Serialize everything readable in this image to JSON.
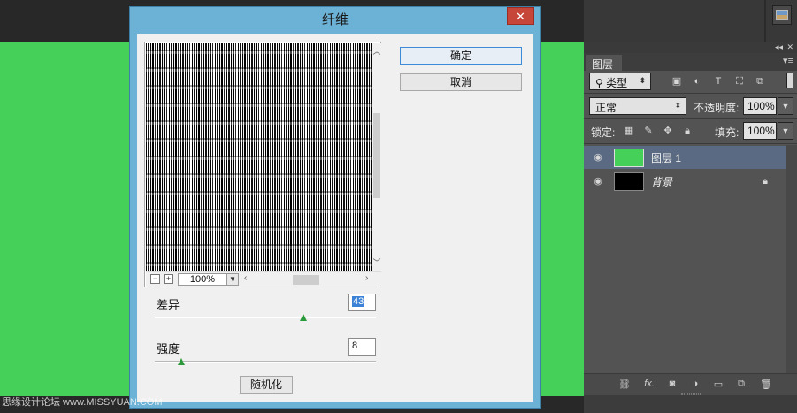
{
  "dialog": {
    "title": "纤维",
    "close_label": "✕",
    "ok_label": "确定",
    "cancel_label": "取消",
    "zoom": "100%",
    "variance_label": "差异",
    "variance_value": "43",
    "variance_fraction": 0.67,
    "strength_label": "强度",
    "strength_value": "8",
    "strength_fraction": 0.12,
    "randomize_label": "随机化",
    "zoom_out_label": "−",
    "zoom_in_label": "+"
  },
  "layers_panel": {
    "tab_label": "图层",
    "filter_kind": "类型",
    "blend_mode": "正常",
    "opacity_label": "不透明度:",
    "opacity_value": "100%",
    "lock_label": "锁定:",
    "fill_label": "填充:",
    "fill_value": "100%",
    "layers": [
      {
        "name": "图层 1",
        "thumb_color": "#45d05a",
        "selected": true
      },
      {
        "name": "背景",
        "thumb_color": "#000000",
        "locked": true
      }
    ]
  },
  "colors": {
    "canvas": "#45d05a",
    "dialog_frame": "#6cb2d6",
    "close_button": "#c7463a",
    "panel_bg": "#535353",
    "selected_layer": "#5a6a82"
  },
  "watermark": "思缘设计论坛 www.MISSYUAN.COM"
}
